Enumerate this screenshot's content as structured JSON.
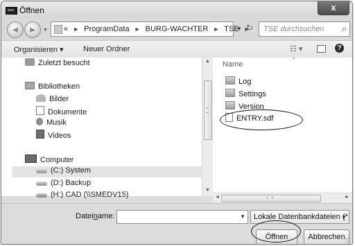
{
  "window": {
    "title": "Öffnen",
    "close_label": "x"
  },
  "nav": {
    "back_glyph": "◄",
    "forward_glyph": "►",
    "breadcrumb_prefix": "«",
    "crumbs": [
      "ProgramData",
      "BURG-WACHTER",
      "TSE"
    ],
    "crumb_separator": "►",
    "search_placeholder": "TSE durchsuchen",
    "refresh_glyph": "↻"
  },
  "toolbar": {
    "organize_label": "Organisieren ▾",
    "new_folder_label": "Neuer Ordner"
  },
  "navpane": {
    "recent": "Zuletzt besucht",
    "libraries": "Bibliotheken",
    "library_items": [
      "Bilder",
      "Dokumente",
      "Musik",
      "Videos"
    ],
    "computer": "Computer",
    "drives": [
      "(C:) System",
      "(D:) Backup",
      "(H:) CAD (\\\\SMEDV15)"
    ],
    "selected": "(C:) System"
  },
  "filelist": {
    "column_name": "Name",
    "folders": [
      "Log",
      "Settings",
      "Version"
    ],
    "files": [
      "ENTRY.sdf"
    ],
    "highlighted_file": "ENTRY.sdf"
  },
  "bottom": {
    "filename_label_pre": "Datei",
    "filename_label_accel": "n",
    "filename_label_post": "ame:",
    "filename_value": "",
    "filter_value": "Lokale Datenbankdateien (*",
    "open_label": "Öffnen",
    "cancel_label": "Abbrechen"
  },
  "colors": {
    "window_bg": "#dcdcdc",
    "close_button": "#5e5e5e",
    "selection": "#e4e4e4",
    "annotation": "#111111"
  }
}
